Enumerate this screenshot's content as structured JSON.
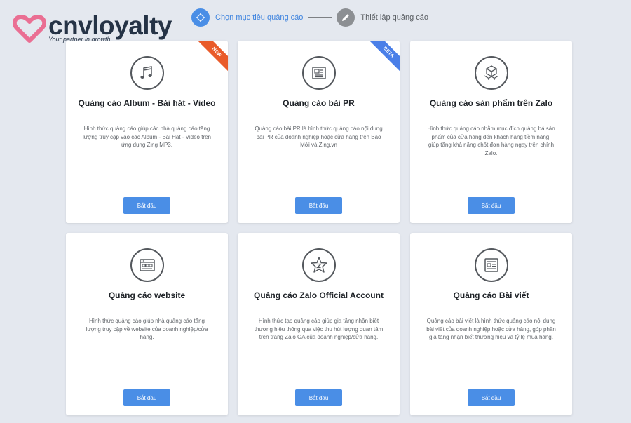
{
  "brand": {
    "name": "cnvloyalty",
    "tagline": "Your partner in growth",
    "heart_color": "#ea6f93",
    "text_color": "#253346"
  },
  "stepper": {
    "steps": [
      {
        "label": "Chọn mục tiêu quảng cáo",
        "state": "active",
        "icon": "crosshair-icon"
      },
      {
        "label": "Thiết lập quảng cáo",
        "state": "inactive",
        "icon": "pencil-icon"
      }
    ]
  },
  "colors": {
    "accent": "#4a8ee6",
    "background": "#e4e8ef",
    "ribbon_new": "#e95b2a",
    "ribbon_beta": "#4a7fe8"
  },
  "cards": [
    {
      "title": "Quảng cáo Album - Bài hát - Video",
      "description": "Hình thức quảng cáo giúp các nhà quảng cáo tăng lượng truy cập vào các Album - Bài Hát - Video trên ứng dụng Zing MP3.",
      "button": "Bắt đầu",
      "icon": "music-note-icon",
      "badge": "NEW"
    },
    {
      "title": "Quảng cáo bài PR",
      "description": "Quảng cáo bài PR là hình thức quảng cáo nội dung bài PR của doanh nghiệp hoặc cửa hàng trên Báo Mới và Zing.vn",
      "button": "Bắt đầu",
      "icon": "newspaper-icon",
      "badge": "BETA"
    },
    {
      "title": "Quảng cáo sản phẩm trên Zalo",
      "description": "Hình thức quảng cáo nhằm mục đích quảng bá sản phẩm của cửa hàng đến khách hàng tiềm năng, giúp tăng khả năng chốt đơn hàng ngay trên chính Zalo.",
      "button": "Bắt đầu",
      "icon": "product-boxes-icon"
    },
    {
      "title": "Quảng cáo website",
      "description": "Hình thức quảng cáo giúp nhà quảng cáo tăng lượng truy cập về website của doanh nghiệp/cửa hàng.",
      "button": "Bắt đầu",
      "icon": "website-icon"
    },
    {
      "title": "Quảng cáo Zalo Official Account",
      "description": "Hình thức tạo quảng cáo giúp gia tăng nhận biết thương hiệu thông qua việc thu hút lượng quan tâm trên trang Zalo OA của doanh nghiệp/cửa hàng.",
      "button": "Bắt đầu",
      "icon": "star-z-icon"
    },
    {
      "title": "Quảng cáo Bài viết",
      "description": "Quảng cáo bài viết là hình thức quảng cáo nội dung bài viết của doanh nghiệp hoặc cửa hàng, góp phần gia tăng nhận biết thương hiệu và tỷ lệ mua hàng.",
      "button": "Bắt đầu",
      "icon": "article-icon"
    }
  ]
}
